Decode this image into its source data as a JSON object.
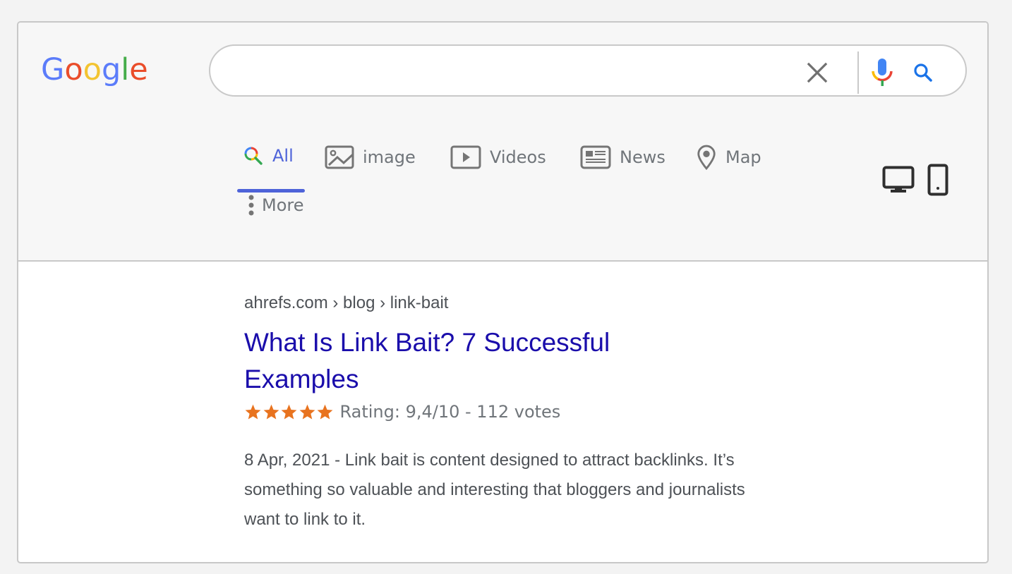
{
  "logo": {
    "letters": [
      "G",
      "o",
      "o",
      "g",
      "l",
      "e"
    ],
    "colors": [
      "#5b7cfa",
      "#ea4d2a",
      "#f3c431",
      "#5b7cfa",
      "#45ad4a",
      "#ea4d2a"
    ]
  },
  "search": {
    "value": "",
    "placeholder": "",
    "clear_icon": "close-icon",
    "mic_icon": "microphone-icon",
    "search_icon": "search-icon"
  },
  "tabs": [
    {
      "label": "All",
      "icon": "search-icon",
      "active": true
    },
    {
      "label": "image",
      "icon": "image-icon",
      "active": false
    },
    {
      "label": "Videos",
      "icon": "video-icon",
      "active": false
    },
    {
      "label": "News",
      "icon": "newspaper-icon",
      "active": false
    },
    {
      "label": "Map",
      "icon": "map-pin-icon",
      "active": false
    }
  ],
  "more": {
    "label": "More",
    "icon": "vertical-dots-icon"
  },
  "device_toggle": {
    "desktop_icon": "desktop-icon",
    "mobile_icon": "mobile-icon"
  },
  "result": {
    "breadcrumb": "ahrefs.com › blog › link-bait",
    "title": "What Is Link Bait? 7 Successful Examples",
    "stars": 5,
    "rating_text": "Rating: 9,4/10 - 112 votes",
    "snippet": "8 Apr, 2021 - Link bait is content designed to attract backlinks. It’s something so valuable and interesting that bloggers and journalists want to link to it."
  },
  "colors": {
    "accent": "#4e63d9",
    "link": "#1a0dab",
    "star": "#e8731f",
    "muted_text": "#70757a"
  }
}
